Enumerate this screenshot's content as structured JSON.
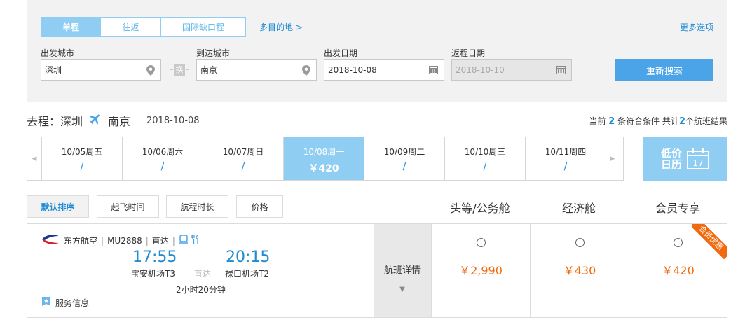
{
  "search": {
    "trip_tabs": [
      "单程",
      "往返",
      "国际缺口程"
    ],
    "multi_city": "多目的地 >",
    "more_options": "更多选项",
    "from_label": "出发城市",
    "from_value": "深圳",
    "swap_label": "换",
    "to_label": "到达城市",
    "to_value": "南京",
    "depart_label": "出发日期",
    "depart_value": "2018-10-08",
    "return_label": "返程日期",
    "return_value": "2018-10-10",
    "search_button": "重新搜索"
  },
  "route": {
    "prefix": "去程：深圳",
    "to": "南京",
    "date": "2018-10-08",
    "count_prefix": "当前",
    "count_current": "2",
    "count_mid": "条符合条件 共计",
    "count_total": "2",
    "count_suffix": "个航班结果"
  },
  "dates": [
    {
      "date": "10/05周五",
      "price": "/"
    },
    {
      "date": "10/06周六",
      "price": "/"
    },
    {
      "date": "10/07周日",
      "price": "/"
    },
    {
      "date": "10/08周一",
      "price": "￥420"
    },
    {
      "date": "10/09周二",
      "price": "/"
    },
    {
      "date": "10/10周三",
      "price": "/"
    },
    {
      "date": "10/11周四",
      "price": "/"
    }
  ],
  "calendar": {
    "line1": "低价",
    "line2": "日历",
    "day": "17"
  },
  "sort": {
    "default": "默认排序",
    "depart_time": "起飞时间",
    "duration": "航程时长",
    "price": "价格"
  },
  "cabins": {
    "first": "头等/公务舱",
    "economy": "经济舱",
    "member": "会员专享"
  },
  "flight": {
    "airline": "东方航空",
    "flight_no": "MU2888",
    "direct": "直达",
    "dep_time": "17:55",
    "arr_time": "20:15",
    "dep_airport": "宝安机场T3",
    "arr_airport": "禄口机场T2",
    "mid_label": "— 直达 —",
    "duration": "2小时20分钟",
    "service": "服务信息",
    "detail": "航班详情",
    "price_first": "￥2,990",
    "price_economy": "￥430",
    "price_member": "￥420",
    "ribbon": "会员优惠"
  },
  "colors": {
    "accent": "#8fcdf3",
    "link": "#1e8bd3",
    "price": "#f26a10",
    "button": "#4ba3e8"
  }
}
